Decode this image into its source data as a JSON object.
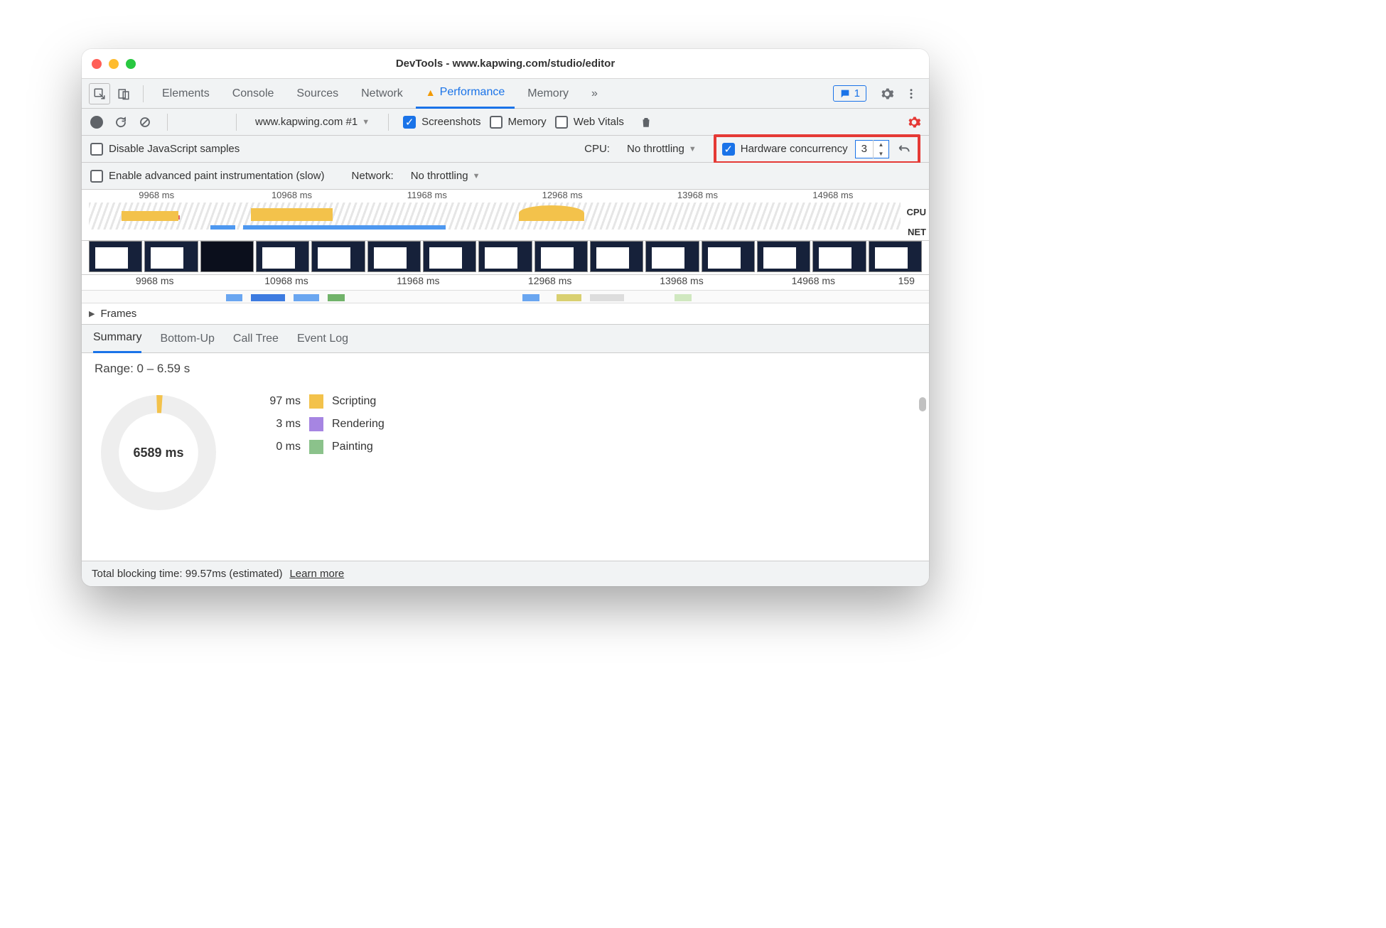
{
  "window": {
    "title": "DevTools - www.kapwing.com/studio/editor"
  },
  "tabs": {
    "items": [
      "Elements",
      "Console",
      "Sources",
      "Network",
      "Performance",
      "Memory"
    ],
    "active": "Performance",
    "more": "»",
    "messages_count": "1"
  },
  "toolbar": {
    "target": "www.kapwing.com #1",
    "screenshots_label": "Screenshots",
    "memory_label": "Memory",
    "webvitals_label": "Web Vitals"
  },
  "options": {
    "disable_js_label": "Disable JavaScript samples",
    "cpu_label": "CPU:",
    "cpu_value": "No throttling",
    "hw_label": "Hardware concurrency",
    "hw_value": "3",
    "paint_label": "Enable advanced paint instrumentation (slow)",
    "net_label": "Network:",
    "net_value": "No throttling"
  },
  "ruler": {
    "marks": [
      "9968 ms",
      "10968 ms",
      "11968 ms",
      "12968 ms",
      "13968 ms",
      "14968 ms"
    ],
    "cpu_label": "CPU",
    "net_label": "NET",
    "marks2": [
      "9968 ms",
      "10968 ms",
      "11968 ms",
      "12968 ms",
      "13968 ms",
      "14968 ms",
      "159"
    ]
  },
  "frames": {
    "label": "Frames"
  },
  "subtabs": {
    "items": [
      "Summary",
      "Bottom-Up",
      "Call Tree",
      "Event Log"
    ],
    "active": "Summary"
  },
  "summary": {
    "range": "Range: 0 – 6.59 s",
    "center": "6589 ms",
    "legend": [
      {
        "ms": "97 ms",
        "label": "Scripting",
        "color": "scripting"
      },
      {
        "ms": "3 ms",
        "label": "Rendering",
        "color": "rendering"
      },
      {
        "ms": "0 ms",
        "label": "Painting",
        "color": "painting"
      }
    ]
  },
  "footer": {
    "text": "Total blocking time: 99.57ms (estimated)",
    "link": "Learn more"
  }
}
